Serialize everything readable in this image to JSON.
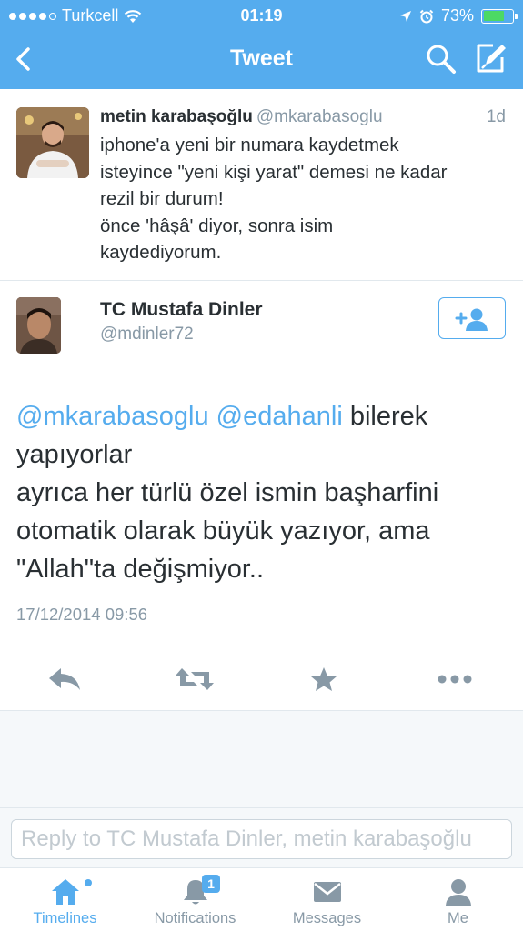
{
  "status_bar": {
    "carrier": "Turkcell",
    "time": "01:19",
    "battery_percent_label": "73%",
    "battery_level": 0.73
  },
  "nav": {
    "title": "Tweet",
    "back_icon": "chevron-left-icon",
    "search_icon": "search-icon",
    "compose_icon": "compose-icon"
  },
  "previous_tweet": {
    "name": "metin karabaşoğlu",
    "handle": "@mkarabasoglu",
    "time": "1d",
    "lines": [
      "iphone'a yeni bir numara kaydetmek",
      "isteyince \"yeni kişi yarat\" demesi ne kadar",
      "rezil bir durum!",
      "önce 'hâşâ' diyor, sonra isim",
      "kaydediyorum."
    ]
  },
  "tweet": {
    "name": "TC Mustafa Dinler",
    "handle": "@mdinler72",
    "mention1": "@mkarabasoglu",
    "mention2": "@edahanli",
    "line1_rest": " bilerek",
    "line2": "yapıyorlar",
    "line3": "ayrıca her türlü özel ismin başharfini",
    "line4": "otomatik olarak büyük yazıyor, ama",
    "line5": "\"Allah\"ta değişmiyor..",
    "date": "17/12/2014 09:56"
  },
  "actions": [
    "reply-icon",
    "retweet-icon",
    "favorite-icon",
    "more-icon"
  ],
  "reply": {
    "placeholder": "Reply to TC Mustafa Dinler, metin karabaşoğlu"
  },
  "tabs": [
    {
      "label": "Timelines",
      "active": true
    },
    {
      "label": "Notifications",
      "badge": "1"
    },
    {
      "label": "Messages"
    },
    {
      "label": "Me"
    }
  ],
  "colors": {
    "brand": "#55acee",
    "text": "#292f33",
    "muted": "#8899a6",
    "battery": "#4cd964"
  }
}
